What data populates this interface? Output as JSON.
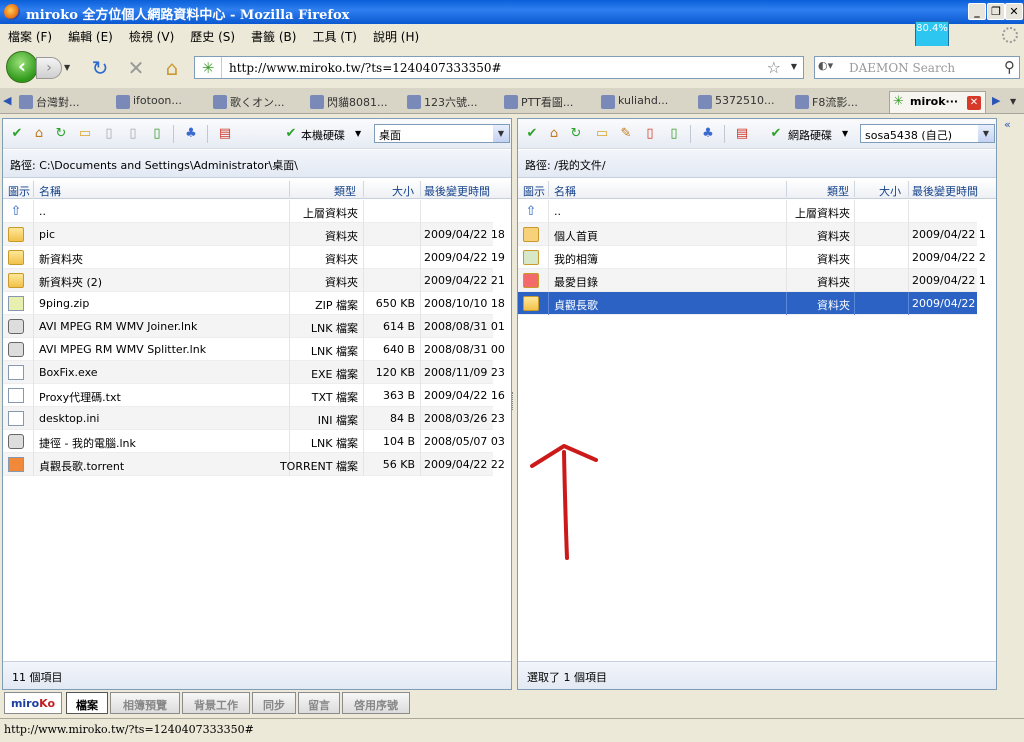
{
  "window": {
    "title": "miroko 全方位個人網路資料中心 - Mozilla Firefox",
    "percent_badge": "80.4%"
  },
  "menu": [
    "檔案 (F)",
    "編輯 (E)",
    "檢視 (V)",
    "歷史 (S)",
    "書籤 (B)",
    "工具 (T)",
    "說明 (H)"
  ],
  "navbar": {
    "url": "http://www.miroko.tw/?ts=1240407333350#",
    "search_placeholder": "DAEMON Search"
  },
  "tabs": [
    {
      "label": "台灣對..."
    },
    {
      "label": "ifotoon..."
    },
    {
      "label": "歌くオン..."
    },
    {
      "label": "閃貓8081..."
    },
    {
      "label": "123六號..."
    },
    {
      "label": "PTT看圖..."
    },
    {
      "label": "kuliahd..."
    },
    {
      "label": "5372510..."
    },
    {
      "label": "F8流影..."
    },
    {
      "label": "mirok···",
      "active": true
    }
  ],
  "left_pane": {
    "location_label": "本機硬碟",
    "folder_select": "桌面",
    "path": "路徑: C:\\Documents and Settings\\Administrator\\桌面\\",
    "columns": {
      "icon": "圖示",
      "name": "名稱",
      "type": "類型",
      "size": "大小",
      "modified": "最後變更時間"
    },
    "rows": [
      {
        "icon": "up",
        "name": "..",
        "type": "上層資料夾",
        "size": "",
        "modified": ""
      },
      {
        "icon": "folder",
        "name": "pic",
        "type": "資料夾",
        "size": "",
        "modified": "2009/04/22 18"
      },
      {
        "icon": "folder",
        "name": "新資料夾",
        "type": "資料夾",
        "size": "",
        "modified": "2009/04/22 19"
      },
      {
        "icon": "folder",
        "name": "新資料夾 (2)",
        "type": "資料夾",
        "size": "",
        "modified": "2009/04/22 21"
      },
      {
        "icon": "zip",
        "name": "9ping.zip",
        "type": "ZIP 檔案",
        "size": "650 KB",
        "modified": "2008/10/10 18"
      },
      {
        "icon": "lnk",
        "name": "AVI MPEG RM WMV Joiner.lnk",
        "type": "LNK 檔案",
        "size": "614 B",
        "modified": "2008/08/31 01"
      },
      {
        "icon": "lnk",
        "name": "AVI MPEG RM WMV Splitter.lnk",
        "type": "LNK 檔案",
        "size": "640 B",
        "modified": "2008/08/31 00"
      },
      {
        "icon": "exe",
        "name": "BoxFix.exe",
        "type": "EXE 檔案",
        "size": "120 KB",
        "modified": "2008/11/09 23"
      },
      {
        "icon": "txt",
        "name": "Proxy代理碼.txt",
        "type": "TXT 檔案",
        "size": "363 B",
        "modified": "2009/04/22 16"
      },
      {
        "icon": "ini",
        "name": "desktop.ini",
        "type": "INI 檔案",
        "size": "84 B",
        "modified": "2008/03/26 23"
      },
      {
        "icon": "lnk",
        "name": "捷徑 - 我的電腦.lnk",
        "type": "LNK 檔案",
        "size": "104 B",
        "modified": "2008/05/07 03"
      },
      {
        "icon": "torrent",
        "name": "貞觀長歌.torrent",
        "type": "TORRENT 檔案",
        "size": "56 KB",
        "modified": "2009/04/22 22"
      }
    ],
    "status": "11 個項目"
  },
  "right_pane": {
    "location_label": "網路硬碟",
    "folder_select": "sosa5438 (自己)",
    "path": "路徑: /我的文件/",
    "columns": {
      "icon": "圖示",
      "name": "名稱",
      "type": "類型",
      "size": "大小",
      "modified": "最後變更時間"
    },
    "rows": [
      {
        "icon": "up",
        "name": "..",
        "type": "上層資料夾",
        "size": "",
        "modified": ""
      },
      {
        "icon": "home",
        "name": "個人首頁",
        "type": "資料夾",
        "size": "",
        "modified": "2009/04/22 1"
      },
      {
        "icon": "album",
        "name": "我的相簿",
        "type": "資料夾",
        "size": "",
        "modified": "2009/04/22 2"
      },
      {
        "icon": "fav",
        "name": "最愛目錄",
        "type": "資料夾",
        "size": "",
        "modified": "2009/04/22 1"
      },
      {
        "icon": "folder",
        "name": "貞觀長歌",
        "type": "資料夾",
        "size": "",
        "modified": "2009/04/22 2",
        "selected": true
      }
    ],
    "status": "選取了 1 個項目"
  },
  "app_tabs": [
    {
      "label": "檔案",
      "active": true
    },
    {
      "label": "相簿預覽"
    },
    {
      "label": "背景工作"
    },
    {
      "label": "同步"
    },
    {
      "label": "留言"
    },
    {
      "label": "啓用序號"
    }
  ],
  "app_logo": {
    "part1": "miro",
    "part2": "Ko"
  },
  "statusbar": {
    "text": "http://www.miroko.tw/?ts=1240407333350#"
  },
  "colors": {
    "selection": "#2b62c4",
    "header_text": "#15428b",
    "titlebar": "#0a5fd8",
    "badge": "#2cc6f0"
  }
}
